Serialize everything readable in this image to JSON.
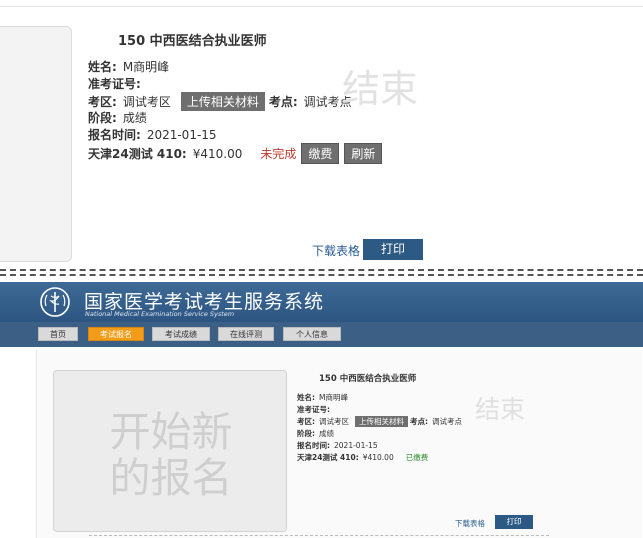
{
  "top_view": {
    "exam_title": "150 中西医结合执业医师",
    "name_label": "姓名:",
    "name_value": "M商明峰",
    "ticket_label": "准考证号:",
    "area_label": "考区:",
    "area_value": "调试考区",
    "upload_button": "上传相关材料",
    "site_label": "考点:",
    "site_value": "调试考点",
    "stage_label": "阶段:",
    "stage_value": "成绩",
    "reg_time_label": "报名时间:",
    "reg_time_value": "2021-01-15",
    "fee_label": "天津24测试 410:",
    "fee_value": "¥410.00",
    "status": "未完成",
    "pay_button": "缴费",
    "refresh_button": "刷新",
    "stamp": "结束",
    "download_link": "下载表格",
    "print_button": "打印"
  },
  "header": {
    "title": "国家医学考试考生服务系统",
    "subtitle": "National Medical Examination Service System"
  },
  "nav": {
    "items": [
      "首页",
      "考试报名",
      "考试成绩",
      "在线评测",
      "个人信息"
    ],
    "active": "考试报名"
  },
  "bottom_view": {
    "card_line1": "开始新",
    "card_line2": "的报名",
    "exam_title": "150 中西医结合执业医师",
    "name_label": "姓名:",
    "name_value": "M商明峰",
    "ticket_label": "准考证号:",
    "area_label": "考区:",
    "area_value": "调试考区",
    "upload_button": "上传相关材料",
    "site_label": "考点:",
    "site_value": "调试考点",
    "stage_label": "阶段:",
    "stage_value": "成绩",
    "reg_time_label": "报名时间:",
    "reg_time_value": "2021-01-15",
    "fee_label": "天津24测试 410:",
    "fee_value": "¥410.00",
    "status": "已缴费",
    "stamp": "结束",
    "download_link": "下载表格",
    "print_button": "打印"
  },
  "colors": {
    "header_blue": "#2c5582",
    "nav_active": "#f39c1a",
    "print_button": "#2d5a84",
    "status_unpaid": "#c0392b",
    "status_paid": "#2e8b2e"
  }
}
